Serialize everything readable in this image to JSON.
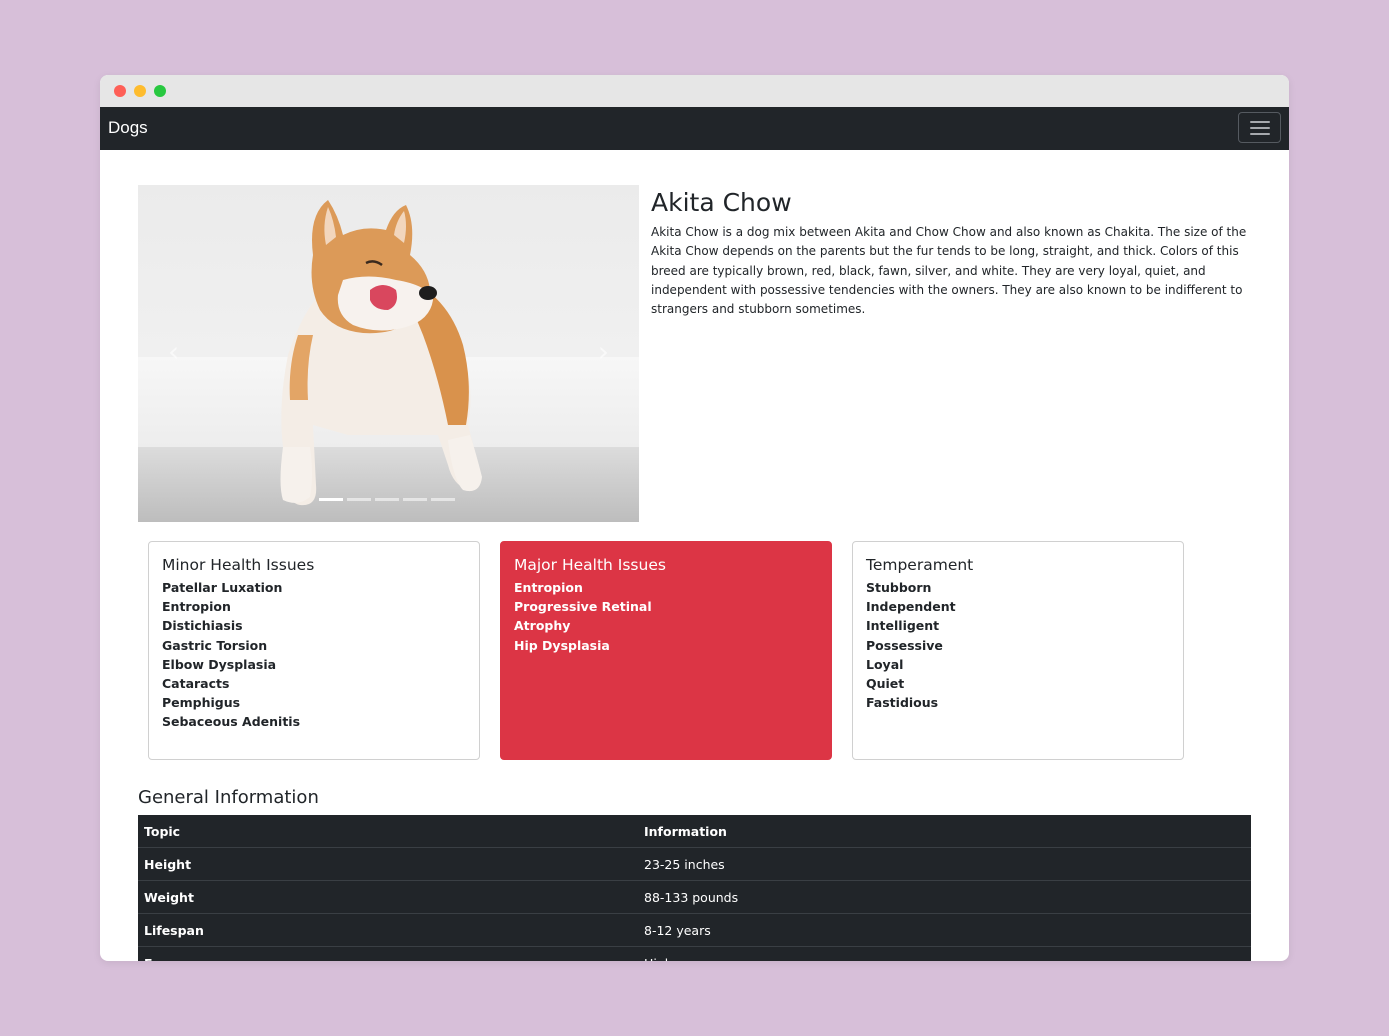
{
  "navbar": {
    "brand": "Dogs",
    "menu_icon": "hamburger-menu-icon"
  },
  "carousel": {
    "prev_icon": "chevron-left-icon",
    "next_icon": "chevron-right-icon",
    "prev_glyph": "‹",
    "next_glyph": "›",
    "slide_count": 5,
    "active_slide": 1
  },
  "breed": {
    "name": "Akita Chow",
    "description": "Akita Chow is a dog mix between Akita and Chow Chow and also known as Chakita. The size of the Akita Chow depends on the parents but the fur tends to be long, straight, and thick. Colors of this breed are typically brown, red, black, fawn, silver, and white. They are very loyal, quiet, and independent with possessive tendencies with the owners. They are also known to be indifferent to strangers and stubborn sometimes."
  },
  "cards": {
    "minor": {
      "title": "Minor Health Issues",
      "items": [
        "Patellar Luxation",
        "Entropion",
        "Distichiasis",
        "Gastric Torsion",
        "Elbow Dysplasia",
        "Cataracts",
        "Pemphigus",
        "Sebaceous Adenitis"
      ]
    },
    "major": {
      "title": "Major Health Issues",
      "color": "#dc3545",
      "items": [
        "Entropion",
        "Progressive Retinal",
        "Atrophy",
        "Hip Dysplasia"
      ]
    },
    "temperament": {
      "title": "Temperament",
      "items": [
        "Stubborn",
        "Independent",
        "Intelligent",
        "Possessive",
        "Loyal",
        "Quiet",
        "Fastidious"
      ]
    }
  },
  "general": {
    "title": "General Information",
    "headers": {
      "topic": "Topic",
      "information": "Information"
    },
    "rows": [
      {
        "topic": "Height",
        "value": "23-25 inches"
      },
      {
        "topic": "Weight",
        "value": "88-133 pounds"
      },
      {
        "topic": "Lifespan",
        "value": "8-12 years"
      },
      {
        "topic": "Energy",
        "value": "High"
      }
    ]
  }
}
